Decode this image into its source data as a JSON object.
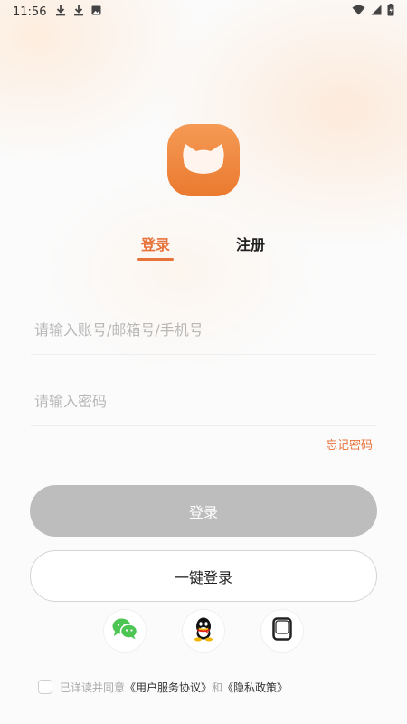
{
  "status_bar": {
    "time": "11:56",
    "left_icons": [
      "download-icon",
      "download-icon",
      "photo-icon"
    ],
    "right_icons": [
      "wifi-icon",
      "signal-icon",
      "battery-icon"
    ]
  },
  "logo": {
    "icon": "cat-face-icon",
    "color": "#ec7f36"
  },
  "tabs": [
    {
      "label": "登录",
      "active": true
    },
    {
      "label": "注册",
      "active": false
    }
  ],
  "form": {
    "account_placeholder": "请输入账号/邮箱号/手机号",
    "password_placeholder": "请输入密码",
    "forgot_label": "忘记密码"
  },
  "buttons": {
    "login_label": "登录",
    "onekey_label": "一键登录"
  },
  "social": [
    {
      "name": "wechat-icon",
      "color": "#4cc552"
    },
    {
      "name": "qq-icon",
      "color": "#111111"
    },
    {
      "name": "device-icon",
      "color": "#222222"
    }
  ],
  "agreement": {
    "prefix": "已详读并同意",
    "link1": "《用户服务协议》",
    "middle": "和",
    "link2": "《隐私政策》",
    "checked": false
  },
  "colors": {
    "accent": "#e8733a",
    "disabled_button": "#bdbdbd"
  }
}
